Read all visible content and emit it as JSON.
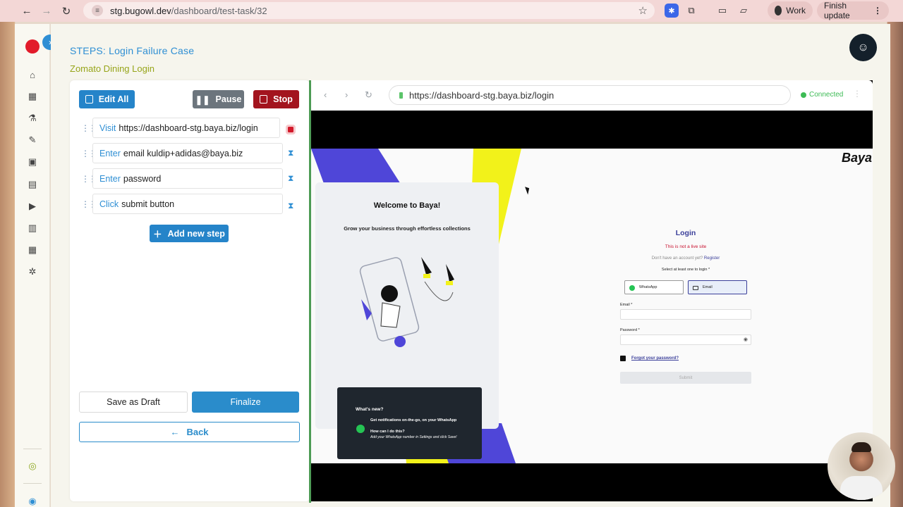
{
  "browser_chrome": {
    "url_host": "stg.bugowl.dev",
    "url_path": "/dashboard/test-task/32",
    "profile_label": "Work",
    "update_label": "Finish update"
  },
  "header": {
    "title": "STEPS: Login Failure Case",
    "subtitle": "Zomato Dining Login"
  },
  "toolbar": {
    "edit_all": "Edit All",
    "pause": "Pause",
    "stop": "Stop"
  },
  "steps": [
    {
      "verb": "Visit",
      "text": "https://dashboard-stg.baya.biz/login",
      "status": "running"
    },
    {
      "verb": "Enter",
      "text": "email kuldip+adidas@baya.biz",
      "status": "pending"
    },
    {
      "verb": "Enter",
      "text": "password",
      "status": "pending"
    },
    {
      "verb": "Click",
      "text": "submit button",
      "status": "pending"
    }
  ],
  "actions": {
    "add_step": "Add new step",
    "save_draft": "Save as Draft",
    "finalize": "Finalize",
    "back": "Back"
  },
  "embedded_browser": {
    "url": "https://dashboard-stg.baya.biz/login",
    "status": "Connected"
  },
  "baya_page": {
    "brand": "Baya",
    "welcome_title": "Welcome to Baya!",
    "welcome_tagline": "Grow your business through effortless collections",
    "whats_new_title": "What's new?",
    "whats_new_line1": "Get notifications on-the-go, on your WhatsApp",
    "whats_new_q": "How can I do this?",
    "whats_new_a": "Add your WhatsApp number in Settings and click Save!",
    "login_title": "Login",
    "live_warning": "This is not a live site",
    "no_account": "Don't have an account yet?",
    "register": "Register",
    "select_prompt": "Select at least one to login *",
    "opt_whatsapp": "WhatsApp",
    "opt_email": "Email",
    "email_label": "Email *",
    "password_label": "Password *",
    "forgot": "Forgot your password?",
    "submit": "Submit"
  },
  "colors": {
    "accent": "#2584c9",
    "stop": "#a3141e",
    "connected": "#3dbb55",
    "baya_blue": "#4f46d8",
    "baya_yellow": "#f2f21a"
  }
}
